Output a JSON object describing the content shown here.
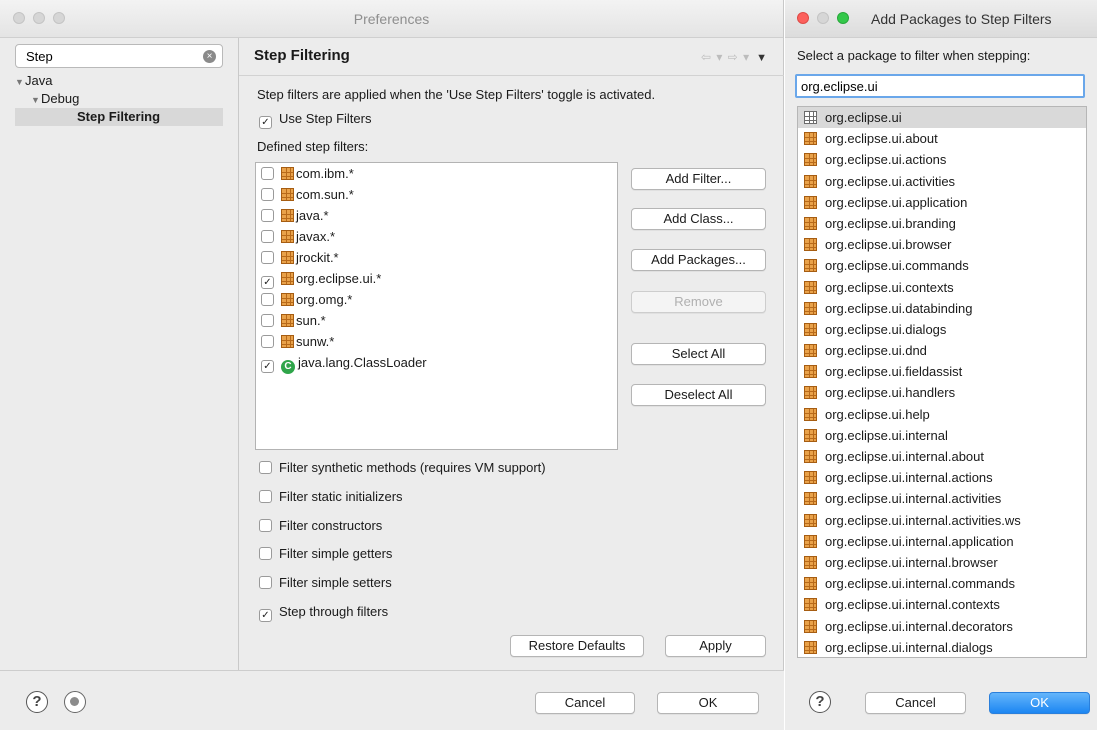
{
  "prefs": {
    "title": "Preferences",
    "search": {
      "value": "Step"
    },
    "tree": [
      "Java",
      "Debug",
      "Step Filtering"
    ],
    "page_title": "Step Filtering",
    "nav_glyph": "⇦ ▾ ⇨ ▾",
    "menu_glyph": "▼",
    "description": "Step filters are applied when the 'Use Step Filters' toggle is activated.",
    "use_step_filters": {
      "label": "Use Step Filters",
      "checked": true
    },
    "defined_label": "Defined step filters:",
    "filters": [
      {
        "label": "com.ibm.*",
        "checked": false,
        "icon": "package-icon"
      },
      {
        "label": "com.sun.*",
        "checked": false,
        "icon": "package-icon"
      },
      {
        "label": "java.*",
        "checked": false,
        "icon": "package-icon"
      },
      {
        "label": "javax.*",
        "checked": false,
        "icon": "package-icon"
      },
      {
        "label": "jrockit.*",
        "checked": false,
        "icon": "package-icon"
      },
      {
        "label": "org.eclipse.ui.*",
        "checked": true,
        "icon": "package-icon"
      },
      {
        "label": "org.omg.*",
        "checked": false,
        "icon": "package-icon"
      },
      {
        "label": "sun.*",
        "checked": false,
        "icon": "package-icon"
      },
      {
        "label": "sunw.*",
        "checked": false,
        "icon": "package-icon"
      },
      {
        "label": "java.lang.ClassLoader",
        "checked": true,
        "icon": "class-icon"
      }
    ],
    "buttons": {
      "add_filter": "Add Filter...",
      "add_class": "Add Class...",
      "add_packages": "Add Packages...",
      "remove": "Remove",
      "select_all": "Select All",
      "deselect_all": "Deselect All",
      "restore_defaults": "Restore Defaults",
      "apply": "Apply",
      "cancel": "Cancel",
      "ok": "OK"
    },
    "options": [
      {
        "label": "Filter synthetic methods (requires VM support)",
        "checked": false
      },
      {
        "label": "Filter static initializers",
        "checked": false
      },
      {
        "label": "Filter constructors",
        "checked": false
      },
      {
        "label": "Filter simple getters",
        "checked": false
      },
      {
        "label": "Filter simple setters",
        "checked": false
      },
      {
        "label": "Step through filters",
        "checked": true
      }
    ],
    "help_glyph": "?"
  },
  "dialog": {
    "title": "Add Packages to Step Filters",
    "prompt": "Select a package to filter when stepping:",
    "input_value": "org.eclipse.ui",
    "packages": [
      "org.eclipse.ui",
      "org.eclipse.ui.about",
      "org.eclipse.ui.actions",
      "org.eclipse.ui.activities",
      "org.eclipse.ui.application",
      "org.eclipse.ui.branding",
      "org.eclipse.ui.browser",
      "org.eclipse.ui.commands",
      "org.eclipse.ui.contexts",
      "org.eclipse.ui.databinding",
      "org.eclipse.ui.dialogs",
      "org.eclipse.ui.dnd",
      "org.eclipse.ui.fieldassist",
      "org.eclipse.ui.handlers",
      "org.eclipse.ui.help",
      "org.eclipse.ui.internal",
      "org.eclipse.ui.internal.about",
      "org.eclipse.ui.internal.actions",
      "org.eclipse.ui.internal.activities",
      "org.eclipse.ui.internal.activities.ws",
      "org.eclipse.ui.internal.application",
      "org.eclipse.ui.internal.browser",
      "org.eclipse.ui.internal.commands",
      "org.eclipse.ui.internal.contexts",
      "org.eclipse.ui.internal.decorators",
      "org.eclipse.ui.internal.dialogs"
    ],
    "selected_index": 0,
    "cancel": "Cancel",
    "ok": "OK",
    "help_glyph": "?"
  },
  "colors": {
    "accent": "#1c86f2",
    "package": "#e9a24a",
    "class": "#2fa54a",
    "close": "#fc605c",
    "zoom": "#34c84a"
  }
}
